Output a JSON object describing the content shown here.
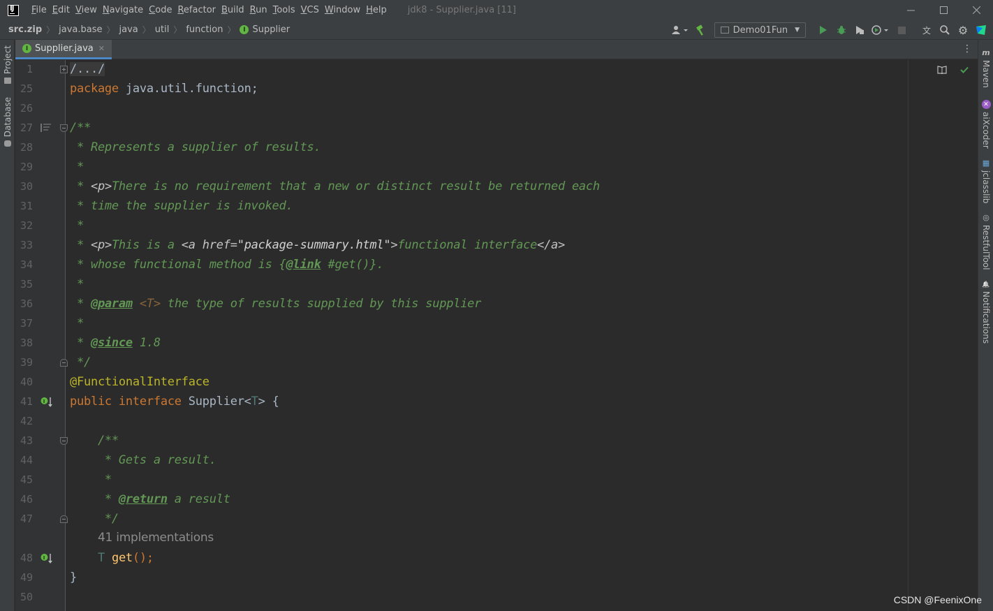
{
  "app": {
    "logo_text": "IJ",
    "window_title": "jdk8 - Supplier.java [11]"
  },
  "menu": [
    {
      "label": "File",
      "mnemonic": "F",
      "rest": "ile"
    },
    {
      "label": "Edit",
      "mnemonic": "E",
      "rest": "dit"
    },
    {
      "label": "View",
      "mnemonic": "V",
      "rest": "iew"
    },
    {
      "label": "Navigate",
      "mnemonic": "N",
      "rest": "avigate"
    },
    {
      "label": "Code",
      "mnemonic": "C",
      "rest": "ode"
    },
    {
      "label": "Refactor",
      "mnemonic": "R",
      "rest": "efactor"
    },
    {
      "label": "Build",
      "mnemonic": "B",
      "rest": "uild"
    },
    {
      "label": "Run",
      "mnemonic": "R",
      "rest": "un"
    },
    {
      "label": "Tools",
      "mnemonic": "T",
      "rest": "ools"
    },
    {
      "label": "VCS",
      "mnemonic": "V",
      "rest": "CS"
    },
    {
      "label": "Window",
      "mnemonic": "W",
      "rest": "indow"
    },
    {
      "label": "Help",
      "mnemonic": "H",
      "rest": "elp"
    }
  ],
  "breadcrumb": [
    "src.zip",
    "java.base",
    "java",
    "util",
    "function",
    "Supplier"
  ],
  "toolbar": {
    "run_config": "Demo01Fun",
    "icons": [
      "user-icon",
      "build-hammer-icon",
      "run-icon",
      "debug-icon",
      "coverage-icon",
      "profile-icon",
      "stop-icon",
      "translate-icon",
      "search-icon",
      "settings-icon",
      "jetbrains-toolbox-icon"
    ]
  },
  "left_tabs": [
    {
      "label": "Project"
    },
    {
      "label": "Database"
    }
  ],
  "right_tabs": [
    {
      "icon": "m",
      "label": "Maven"
    },
    {
      "icon": "✕",
      "label": "aiXcoder"
    },
    {
      "icon": "▦",
      "label": "jclasslib"
    },
    {
      "icon": "◎",
      "label": "RestfulTool"
    },
    {
      "icon": "🔔",
      "label": "Notifications"
    }
  ],
  "editor": {
    "tab_label": "Supplier.java",
    "tab_badge": "I",
    "lines": [
      {
        "n": "1"
      },
      {
        "n": "25"
      },
      {
        "n": "26"
      },
      {
        "n": "27"
      },
      {
        "n": "28"
      },
      {
        "n": "29"
      },
      {
        "n": "30"
      },
      {
        "n": "31"
      },
      {
        "n": "32"
      },
      {
        "n": "33"
      },
      {
        "n": "34"
      },
      {
        "n": "35"
      },
      {
        "n": "36"
      },
      {
        "n": "37"
      },
      {
        "n": "38"
      },
      {
        "n": "39"
      },
      {
        "n": "40"
      },
      {
        "n": "41"
      },
      {
        "n": "42"
      },
      {
        "n": "43"
      },
      {
        "n": "44"
      },
      {
        "n": "45"
      },
      {
        "n": "46"
      },
      {
        "n": "47"
      },
      {
        "n": ""
      },
      {
        "n": "48"
      },
      {
        "n": "49"
      },
      {
        "n": "50"
      }
    ],
    "code": {
      "l1": "/.../",
      "l25_kw": "package",
      "l25_rest": " java.util.function;",
      "l27": "/**",
      "l28": " * Represents a supplier of results.",
      "l29": " *",
      "l30_a": " * ",
      "l30_tag": "<p>",
      "l30_b": "There is no requirement that a new or distinct result be returned each",
      "l31": " * time the supplier is invoked.",
      "l32": " *",
      "l33_a": " * ",
      "l33_p": "<p>",
      "l33_b": "This is a ",
      "l33_atag": "<a ",
      "l33_attr": "href=",
      "l33_val": "\"package-summary.html\"",
      "l33_gt": ">",
      "l33_c": "functional interface",
      "l33_end": "</a>",
      "l34_a": " * whose functional method is {",
      "l34_tag": "@link",
      "l34_b": " #get()}.",
      "l35": " *",
      "l36_a": " * ",
      "l36_tag": "@param",
      "l36_t": " <T>",
      "l36_b": " the type of results supplied by this supplier",
      "l37": " *",
      "l38_a": " * ",
      "l38_tag": "@since",
      "l38_b": " 1.8",
      "l39": " */",
      "l40": "@FunctionalInterface",
      "l41_kw1": "public",
      "l41_kw2": "interface",
      "l41_name": "Supplier<",
      "l41_t": "T",
      "l41_end": "> {",
      "l43": "    /**",
      "l44": "     * Gets a result.",
      "l45": "     *",
      "l46_a": "     * ",
      "l46_tag": "@return",
      "l46_b": " a result",
      "l47": "     */",
      "inlay": "41 implementations",
      "l48_t": "T",
      "l48_m": "get",
      "l48_end": "();",
      "l49": "}"
    }
  },
  "watermark": "CSDN @FeenixOne",
  "colors": {
    "background": "#2b2b2b",
    "keyword": "#cc7832",
    "annotation": "#bbb529",
    "doc_comment": "#629755",
    "method": "#ffc66d",
    "type_param": "#507874",
    "tab_underline": "#4a88c7"
  }
}
